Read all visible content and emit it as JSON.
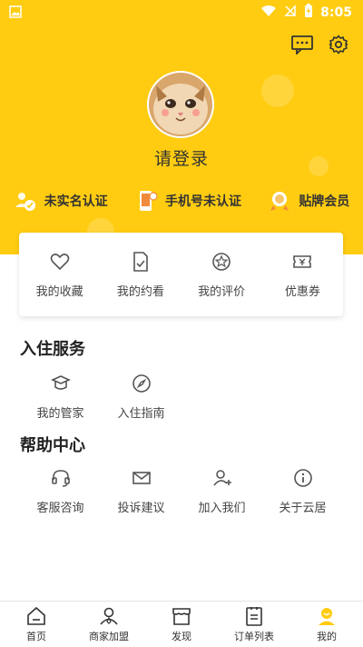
{
  "status_bar": {
    "time": "8:05"
  },
  "header": {
    "login_text": "请登录"
  },
  "badges": [
    {
      "label": "未实名认证",
      "icon": "id-verify-icon"
    },
    {
      "label": "手机号未认证",
      "icon": "phone-verify-icon"
    },
    {
      "label": "贴牌会员",
      "icon": "medal-icon"
    }
  ],
  "quick_actions": [
    {
      "label": "我的收藏",
      "icon": "heart-icon"
    },
    {
      "label": "我的约看",
      "icon": "appointment-icon"
    },
    {
      "label": "我的评价",
      "icon": "review-icon"
    },
    {
      "label": "优惠券",
      "icon": "coupon-icon"
    }
  ],
  "sections": {
    "checkin": {
      "title": "入住服务",
      "items": [
        {
          "label": "我的管家",
          "icon": "butler-icon"
        },
        {
          "label": "入住指南",
          "icon": "compass-icon"
        }
      ]
    },
    "help": {
      "title": "帮助中心",
      "items": [
        {
          "label": "客服咨询",
          "icon": "headset-icon"
        },
        {
          "label": "投诉建议",
          "icon": "mail-icon"
        },
        {
          "label": "加入我们",
          "icon": "add-user-icon"
        },
        {
          "label": "关于云居",
          "icon": "info-icon"
        }
      ]
    }
  },
  "tabbar": [
    {
      "label": "首页",
      "icon": "home-icon"
    },
    {
      "label": "商家加盟",
      "icon": "merchant-icon"
    },
    {
      "label": "发现",
      "icon": "discover-icon"
    },
    {
      "label": "订单列表",
      "icon": "order-list-icon"
    },
    {
      "label": "我的",
      "icon": "profile-icon",
      "active": true
    }
  ],
  "colors": {
    "accent": "#ffcc11",
    "icon_gray": "#555555"
  }
}
